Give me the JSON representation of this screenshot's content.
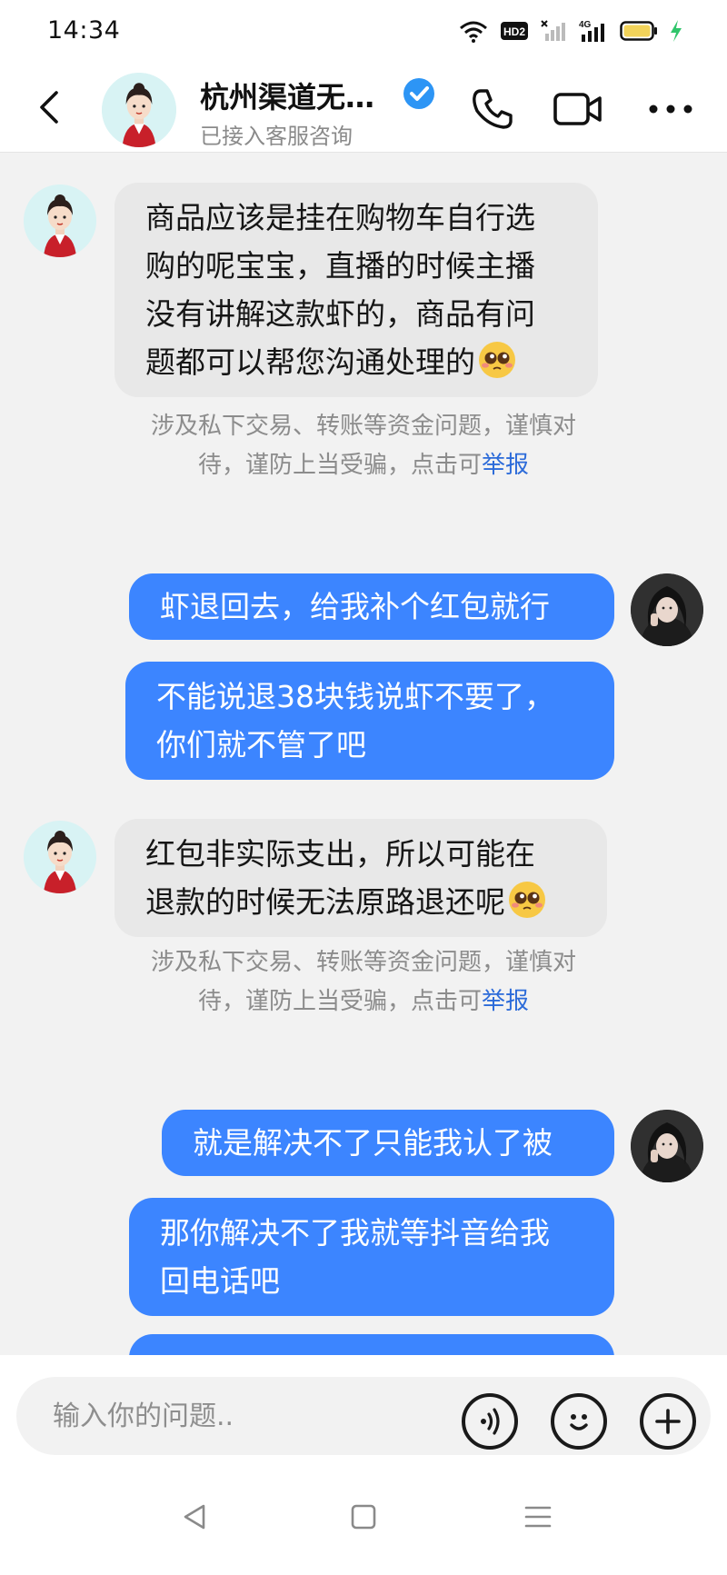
{
  "status_bar": {
    "time": "14:34",
    "hd_badge": "HD2",
    "network": "4G",
    "icons": [
      "wifi-icon",
      "hd-icon",
      "signal-icon",
      "4g-signal-icon",
      "battery-icon",
      "charging-icon"
    ]
  },
  "header": {
    "contact_name": "杭州渠道无…",
    "subtitle": "已接入客服咨询",
    "icons": [
      "back-arrow-icon",
      "verified-icon",
      "phone-icon",
      "video-icon",
      "more-icon"
    ]
  },
  "messages": [
    {
      "sender": "agent",
      "text": "商品应该是挂在购物车自行选购的呢宝宝，直播的时候主播没有讲解这款虾的，商品有问题都可以帮您沟通处理的",
      "lines": [
        "商品应该是挂在购物车自行选",
        "购的呢宝宝，直播的时候主播",
        "没有讲解这款虾的，商品有问",
        "题都可以帮您沟通处理的"
      ],
      "emoji": "pleading-face-emoji"
    },
    {
      "sender": "system",
      "line1": "涉及私下交易、转账等资金问题，谨慎对",
      "line2_prefix": "待，谨防上当受骗，点击可",
      "link": "举报"
    },
    {
      "sender": "user",
      "lines": [
        "虾退回去，给我补个红包就行"
      ]
    },
    {
      "sender": "user",
      "lines": [
        "不能说退38块钱说虾不要了，",
        "你们就不管了吧"
      ]
    },
    {
      "sender": "agent",
      "lines": [
        "红包非实际支出，所以可能在",
        "退款的时候无法原路退还呢"
      ],
      "emoji": "pleading-face-emoji"
    },
    {
      "sender": "system",
      "line1": "涉及私下交易、转账等资金问题，谨慎对",
      "line2_prefix": "待，谨防上当受骗，点击可",
      "link": "举报"
    },
    {
      "sender": "user",
      "lines": [
        "就是解决不了只能我认了被"
      ]
    },
    {
      "sender": "user",
      "lines": [
        "那你解决不了我就等抖音给我",
        "回电话吧"
      ]
    }
  ],
  "input": {
    "placeholder": "输入你的问题..",
    "icons": [
      "voice-icon",
      "emoji-icon",
      "plus-icon"
    ]
  },
  "navbar": {
    "icons": [
      "nav-back-icon",
      "nav-home-icon",
      "nav-menu-icon"
    ]
  },
  "colors": {
    "outgoing_bubble": "#3c85ff",
    "incoming_bubble": "#e8e8e8",
    "report_link": "#2c6bd9",
    "verified_badge": "#2d95f5"
  }
}
